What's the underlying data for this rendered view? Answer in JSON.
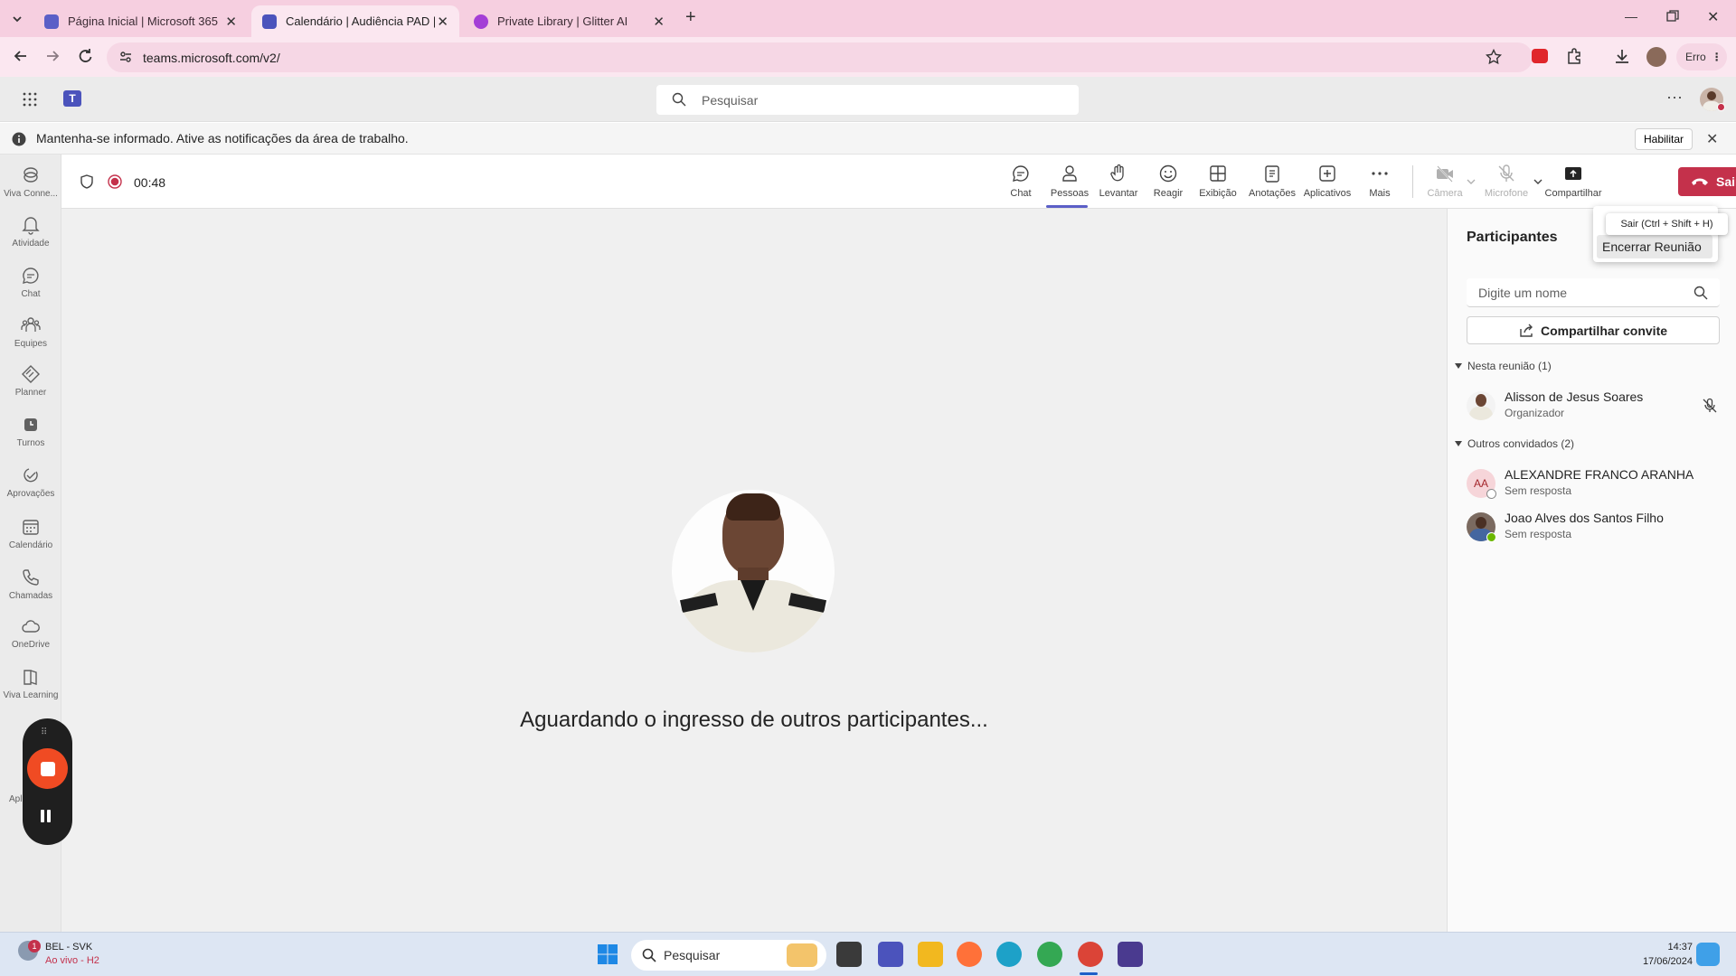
{
  "browser": {
    "tabs": [
      {
        "title": "Página Inicial | Microsoft 365",
        "active": false
      },
      {
        "title": "Calendário | Audiência PAD | Mi",
        "active": true
      },
      {
        "title": "Private Library | Glitter AI",
        "active": false
      }
    ],
    "url": "teams.microsoft.com/v2/",
    "profile_label": "Erro"
  },
  "teams_header": {
    "search_placeholder": "Pesquisar"
  },
  "notification": {
    "message": "Mantenha-se informado. Ative as notificações da área de trabalho.",
    "enable_label": "Habilitar"
  },
  "rail": {
    "items": [
      {
        "label": "Viva Conne...",
        "icon": "viva-connections-icon"
      },
      {
        "label": "Atividade",
        "icon": "bell-icon"
      },
      {
        "label": "Chat",
        "icon": "chat-icon"
      },
      {
        "label": "Equipes",
        "icon": "teams-icon"
      },
      {
        "label": "Planner",
        "icon": "planner-icon"
      },
      {
        "label": "Turnos",
        "icon": "shifts-icon"
      },
      {
        "label": "Aprovações",
        "icon": "approvals-icon"
      },
      {
        "label": "Calendário",
        "icon": "calendar-icon"
      },
      {
        "label": "Chamadas",
        "icon": "phone-icon"
      },
      {
        "label": "OneDrive",
        "icon": "cloud-icon"
      },
      {
        "label": "Viva Learning",
        "icon": "book-icon"
      }
    ],
    "partial_label": "Apl"
  },
  "meeting": {
    "timer": "00:48",
    "toolbar": {
      "chat": "Chat",
      "people": "Pessoas",
      "raise": "Levantar",
      "react": "Reagir",
      "view": "Exibição",
      "notes": "Anotações",
      "apps": "Aplicativos",
      "more": "Mais",
      "camera": "Câmera",
      "mic": "Microfone",
      "share": "Compartilhar",
      "leave": "Sair"
    },
    "waiting_message": "Aguardando o ingresso de outros participantes...",
    "leave_menu": {
      "tooltip": "Sair (Ctrl + Shift + H)",
      "end_meeting": "Encerrar Reunião"
    }
  },
  "participants": {
    "title": "Participantes",
    "search_placeholder": "Digite um nome",
    "share_invite": "Compartilhar convite",
    "in_meeting_label": "Nesta reunião (1)",
    "in_meeting": [
      {
        "name": "Alisson de Jesus Soares",
        "role": "Organizador"
      }
    ],
    "others_label": "Outros convidados (2)",
    "others": [
      {
        "name": "ALEXANDRE FRANCO ARANHA",
        "status": "Sem resposta",
        "initials": "AA"
      },
      {
        "name": "Joao Alves dos Santos Filho",
        "status": "Sem resposta"
      }
    ]
  },
  "taskbar": {
    "weather_badge": "1",
    "weather_title": "BEL - SVK",
    "weather_sub": "Ao vivo - H2",
    "search_placeholder": "Pesquisar",
    "time": "14:37",
    "date": "17/06/2024"
  },
  "colors": {
    "accent": "#5b5fc7",
    "leave_red": "#c4314b",
    "tab_bar": "#f6cfe0"
  }
}
